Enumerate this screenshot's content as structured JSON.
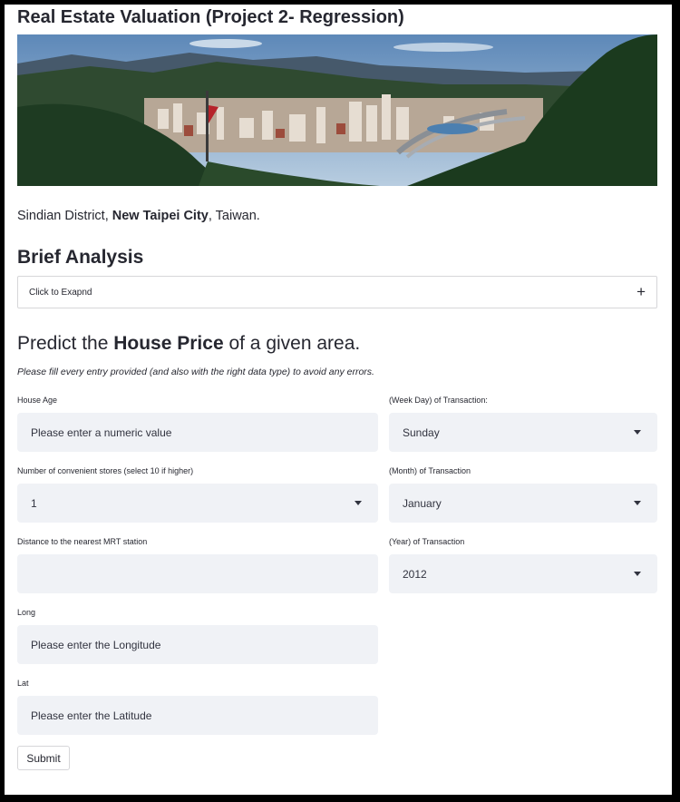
{
  "app": {
    "title": "Real Estate Valuation (Project 2- Regression)"
  },
  "location": {
    "prefix": "Sindian District,",
    "city": "New Taipei City",
    "suffix": ", Taiwan."
  },
  "analysis": {
    "heading": "Brief Analysis",
    "expander_label": "Click to Exapnd",
    "expander_icon": "plus-icon"
  },
  "predict": {
    "heading_pre": "Predict the ",
    "heading_bold": "House Price",
    "heading_post": " of a given area.",
    "note": "Please fill every entry provided (and also with the right data type) to avoid any errors."
  },
  "form": {
    "house_age": {
      "label": "House Age",
      "placeholder": "Please enter a numeric value"
    },
    "stores": {
      "label": "Number of convenient stores (select 10 if higher)",
      "value": "1"
    },
    "mrt": {
      "label": "Distance to the nearest MRT station",
      "value": ""
    },
    "long": {
      "label": "Long",
      "placeholder": "Please enter the Longitude"
    },
    "lat": {
      "label": "Lat",
      "placeholder": "Please enter the Latitude"
    },
    "weekday": {
      "label": "(Week Day) of Transaction:",
      "value": "Sunday"
    },
    "month": {
      "label": "(Month) of Transaction",
      "value": "January"
    },
    "year": {
      "label": "(Year) of Transaction",
      "value": "2012"
    },
    "submit_label": "Submit"
  },
  "colors": {
    "field_bg": "#f0f2f6",
    "text": "#262730",
    "border": "#d6d6d9"
  }
}
